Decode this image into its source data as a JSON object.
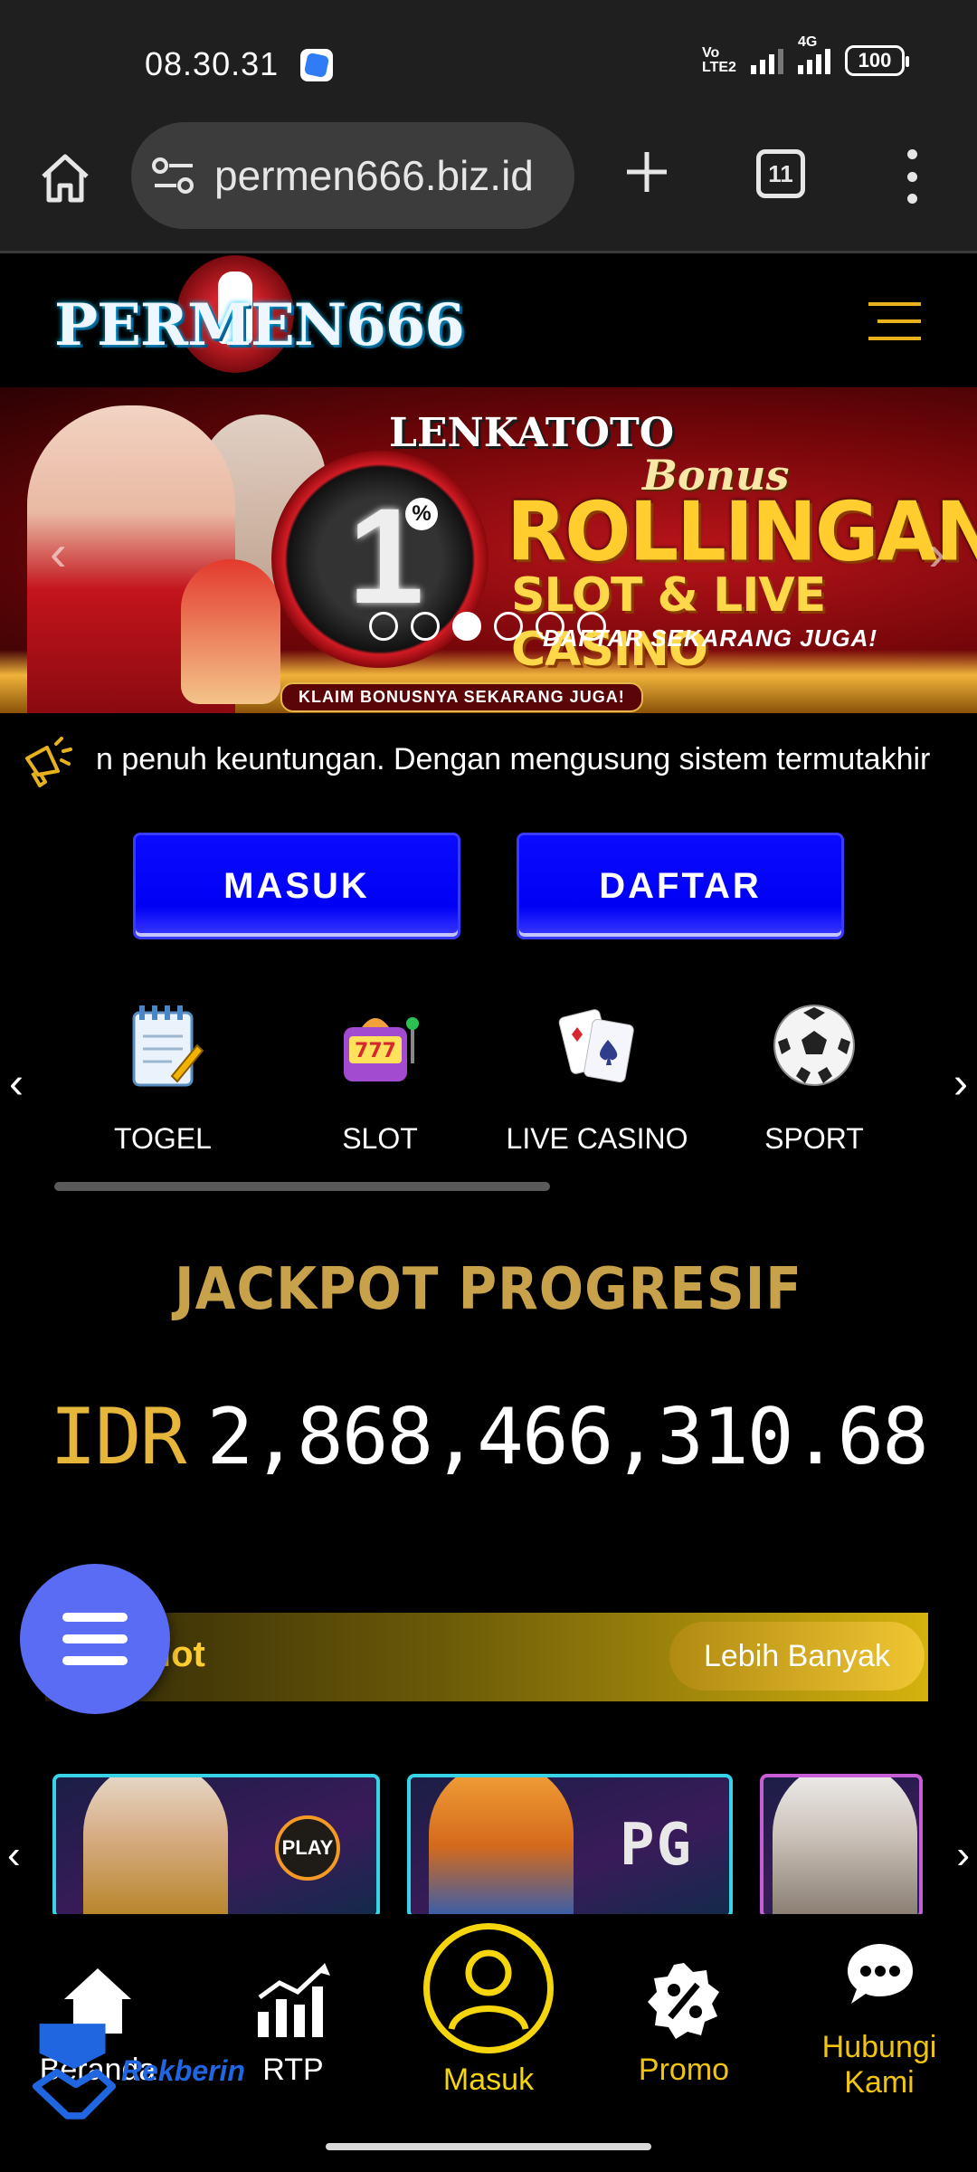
{
  "status_bar": {
    "time": "08.30.31",
    "network": "4G",
    "volte": "Vo LTE2",
    "battery": "100"
  },
  "browser": {
    "url": "permen666.biz.id",
    "tab_count": "11"
  },
  "site": {
    "logo_text": "PERMEN666"
  },
  "banner": {
    "brand": "LENKATOTO",
    "percent": "1",
    "percent_sign": "%",
    "bonus": "Bonus",
    "headline": "ROLLINGAN",
    "subheadline": "SLOT & LIVE CASINO",
    "cta": "DAFTAR SEKARANG JUGA!",
    "claim": "KLAIM BONUSNYA SEKARANG JUGA!",
    "active_slide": 3,
    "slide_count": 6
  },
  "marquee": {
    "text": "n penuh keuntungan. Dengan mengusung sistem termutakhir"
  },
  "auth": {
    "login_label": "MASUK",
    "register_label": "DAFTAR"
  },
  "categories": [
    {
      "label": "TOGEL",
      "icon": "notepad-icon"
    },
    {
      "label": "SLOT",
      "icon": "slot-machine-icon"
    },
    {
      "label": "LIVE CASINO",
      "icon": "playing-cards-icon"
    },
    {
      "label": "SPORT",
      "icon": "soccer-ball-icon"
    }
  ],
  "jackpot": {
    "title": "JACKPOT PROGRESIF",
    "currency": "IDR",
    "amount": "2,868,466,310.68"
  },
  "hot_slot": {
    "title": "lot",
    "more_label": "Lebih Banyak"
  },
  "games": [
    {
      "provider": "PLAY",
      "theme": "zeus"
    },
    {
      "provider": "PG",
      "theme": "warrior"
    },
    {
      "provider": "",
      "theme": "zeus"
    }
  ],
  "bottom_nav": {
    "home": "Beranda",
    "rtp": "RTP",
    "login": "Masuk",
    "promo": "Promo",
    "contact_line1": "Hubungi",
    "contact_line2": "Kami"
  },
  "overlay": {
    "rekberin": "Rekberin"
  },
  "colors": {
    "gold": "#c8a24a",
    "blue_button": "#0000f5",
    "nav_yellow": "#f5d50c",
    "fab": "#5b6cf4"
  }
}
